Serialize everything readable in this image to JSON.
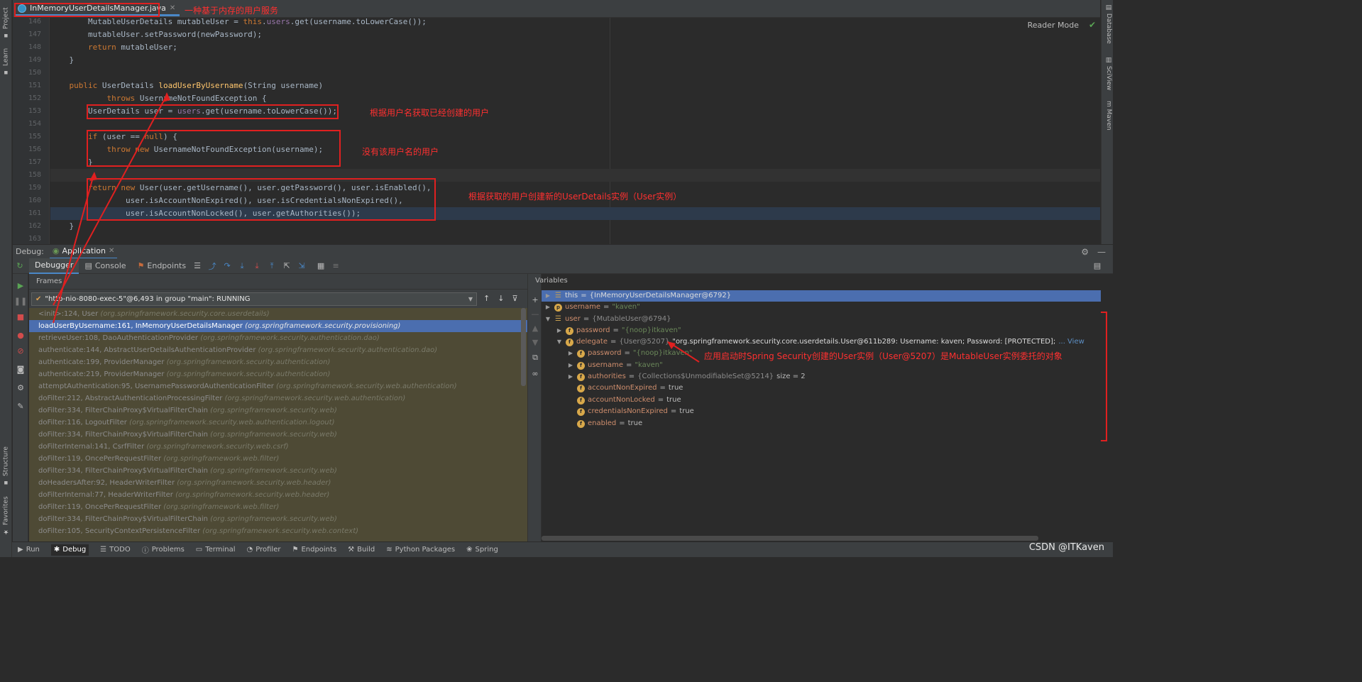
{
  "editor": {
    "file_tab": "InMemoryUserDetailsManager.java",
    "reader_mode": "Reader Mode",
    "lines": [
      {
        "num": "146",
        "code": "        MutableUserDetails mutableUser = this.users.get(username.toLowerCase());"
      },
      {
        "num": "147",
        "code": "        mutableUser.setPassword(newPassword);"
      },
      {
        "num": "148",
        "code": "        return mutableUser;"
      },
      {
        "num": "149",
        "code": "    }"
      },
      {
        "num": "150",
        "code": ""
      },
      {
        "num": "151",
        "code": "    public UserDetails loadUserByUsername(String username)"
      },
      {
        "num": "152",
        "code": "            throws UsernameNotFoundException {"
      },
      {
        "num": "153",
        "code": "        UserDetails user = users.get(username.toLowerCase());"
      },
      {
        "num": "154",
        "code": ""
      },
      {
        "num": "155",
        "code": "        if (user == null) {"
      },
      {
        "num": "156",
        "code": "            throw new UsernameNotFoundException(username);"
      },
      {
        "num": "157",
        "code": "        }"
      },
      {
        "num": "158",
        "code": ""
      },
      {
        "num": "159",
        "code": "        return new User(user.getUsername(), user.getPassword(), user.isEnabled(),"
      },
      {
        "num": "160",
        "code": "                user.isAccountNonExpired(), user.isCredentialsNonExpired(),"
      },
      {
        "num": "161",
        "code": "                user.isAccountNonLocked(), user.getAuthorities());"
      },
      {
        "num": "162",
        "code": "    }"
      },
      {
        "num": "163",
        "code": ""
      }
    ]
  },
  "annotations": {
    "a1": "一种基于内存的用户服务",
    "a2": "根据用户名获取已经创建的用户",
    "a3": "没有该用户名的用户",
    "a4": "根据获取的用户创建新的UserDetails实例（User实例）",
    "a5": "应用启动时Spring Security创建的User实例（User@5207）是MutableUser实例委托的对象"
  },
  "debug": {
    "label": "Debug:",
    "app_tab": "Application",
    "tabs": {
      "debugger": "Debugger",
      "console": "Console",
      "endpoints": "Endpoints"
    },
    "frames_title": "Frames",
    "variables_title": "Variables",
    "thread": "\"http-nio-8080-exec-5\"@6,493 in group \"main\": RUNNING",
    "frames": [
      {
        "m": "<init>:124, User",
        "p": "(org.springframework.security.core.userdetails)"
      },
      {
        "m": "loadUserByUsername:161, InMemoryUserDetailsManager",
        "p": "(org.springframework.security.provisioning)"
      },
      {
        "m": "retrieveUser:108, DaoAuthenticationProvider",
        "p": "(org.springframework.security.authentication.dao)"
      },
      {
        "m": "authenticate:144, AbstractUserDetailsAuthenticationProvider",
        "p": "(org.springframework.security.authentication.dao)"
      },
      {
        "m": "authenticate:199, ProviderManager",
        "p": "(org.springframework.security.authentication)"
      },
      {
        "m": "authenticate:219, ProviderManager",
        "p": "(org.springframework.security.authentication)"
      },
      {
        "m": "attemptAuthentication:95, UsernamePasswordAuthenticationFilter",
        "p": "(org.springframework.security.web.authentication)"
      },
      {
        "m": "doFilter:212, AbstractAuthenticationProcessingFilter",
        "p": "(org.springframework.security.web.authentication)"
      },
      {
        "m": "doFilter:334, FilterChainProxy$VirtualFilterChain",
        "p": "(org.springframework.security.web)"
      },
      {
        "m": "doFilter:116, LogoutFilter",
        "p": "(org.springframework.security.web.authentication.logout)"
      },
      {
        "m": "doFilter:334, FilterChainProxy$VirtualFilterChain",
        "p": "(org.springframework.security.web)"
      },
      {
        "m": "doFilterInternal:141, CsrfFilter",
        "p": "(org.springframework.security.web.csrf)"
      },
      {
        "m": "doFilter:119, OncePerRequestFilter",
        "p": "(org.springframework.web.filter)"
      },
      {
        "m": "doFilter:334, FilterChainProxy$VirtualFilterChain",
        "p": "(org.springframework.security.web)"
      },
      {
        "m": "doHeadersAfter:92, HeaderWriterFilter",
        "p": "(org.springframework.security.web.header)"
      },
      {
        "m": "doFilterInternal:77, HeaderWriterFilter",
        "p": "(org.springframework.security.web.header)"
      },
      {
        "m": "doFilter:119, OncePerRequestFilter",
        "p": "(org.springframework.web.filter)"
      },
      {
        "m": "doFilter:334, FilterChainProxy$VirtualFilterChain",
        "p": "(org.springframework.security.web)"
      },
      {
        "m": "doFilter:105, SecurityContextPersistenceFilter",
        "p": "(org.springframework.security.web.context)"
      }
    ],
    "variables": {
      "this_name": "this",
      "this_val": "{InMemoryUserDetailsManager@6792}",
      "username_name": "username",
      "username_val": "\"kaven\"",
      "user_name": "user",
      "user_val": "{MutableUser@6794}",
      "password_name": "password",
      "password_val": "\"{noop}itkaven\"",
      "delegate_name": "delegate",
      "delegate_val": "{User@5207}",
      "delegate_str": "\"org.springframework.security.core.userdetails.User@611b289: Username: kaven; Password: [PROTECTED]; Enabled: true; A",
      "view_link": "... View",
      "d_password_name": "password",
      "d_password_val": "\"{noop}itkaven\"",
      "d_username_name": "username",
      "d_username_val": "\"kaven\"",
      "authorities_name": "authorities",
      "authorities_val": "{Collections$UnmodifiableSet@5214}",
      "authorities_size": "size = 2",
      "ane_name": "accountNonExpired",
      "ane_val": "true",
      "anl_name": "accountNonLocked",
      "anl_val": "true",
      "cne_name": "credentialsNonExpired",
      "cne_val": "true",
      "en_name": "enabled",
      "en_val": "true",
      "eq": "="
    }
  },
  "sidebars": {
    "project": "Project",
    "learn": "Learn",
    "structure": "Structure",
    "favorites": "Favorites",
    "database": "Database",
    "sciview": "SciView",
    "maven": "Maven"
  },
  "status_bar": [
    "Run",
    "Debug",
    "TODO",
    "Problems",
    "Terminal",
    "Profiler",
    "Endpoints",
    "Build",
    "Python Packages",
    "Spring"
  ],
  "watermark": "CSDN @ITKaven",
  "colors": {
    "accent": "#4a88c7",
    "annotation": "#ff3030",
    "selection": "#4b6eaf"
  }
}
